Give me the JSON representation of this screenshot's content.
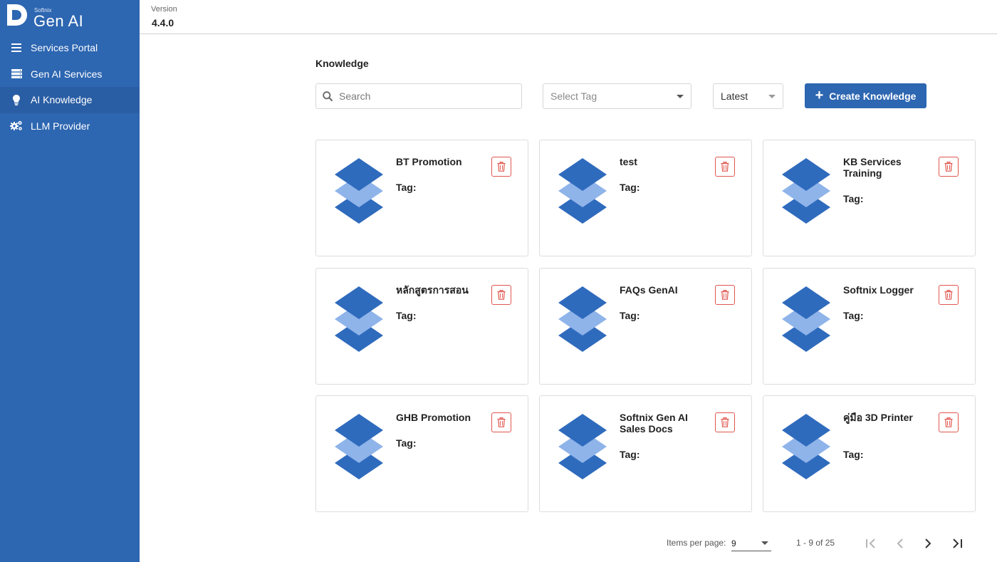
{
  "app": {
    "brand_small": "Softnix",
    "brand_big": "Gen AI"
  },
  "sidebar": {
    "items": [
      {
        "label": "Services Portal",
        "icon": "menu-icon"
      },
      {
        "label": "Gen AI Services",
        "icon": "server-icon"
      },
      {
        "label": "AI Knowledge",
        "icon": "lightbulb-icon",
        "active": true
      },
      {
        "label": "LLM Provider",
        "icon": "cogs-icon"
      }
    ]
  },
  "header": {
    "version_label": "Version",
    "version_value": "4.4.0"
  },
  "main": {
    "title": "Knowledge",
    "search": {
      "placeholder": "Search",
      "value": ""
    },
    "tag_select": {
      "placeholder": "Select Tag"
    },
    "sort_select": {
      "value": "Latest"
    },
    "create_button": "Create Knowledge",
    "tag_label": "Tag:",
    "cards": [
      {
        "title": "BT Promotion"
      },
      {
        "title": "test"
      },
      {
        "title": "KB Services Training"
      },
      {
        "title": "หลักสูตรการสอน"
      },
      {
        "title": "FAQs GenAI"
      },
      {
        "title": "Softnix Logger"
      },
      {
        "title": "GHB Promotion"
      },
      {
        "title": "Softnix Gen AI Sales Docs"
      },
      {
        "title": "คู่มือ 3D Printer"
      }
    ]
  },
  "pagination": {
    "items_per_page_label": "Items per page:",
    "items_per_page_value": "9",
    "range_label": "1 - 9 of 25"
  },
  "colors": {
    "sidebar": "#2d66b1",
    "primary": "#2d66b1",
    "icon_dark": "#2f6bbd",
    "icon_light": "#8fb4ea",
    "delete": "#e0564f"
  }
}
